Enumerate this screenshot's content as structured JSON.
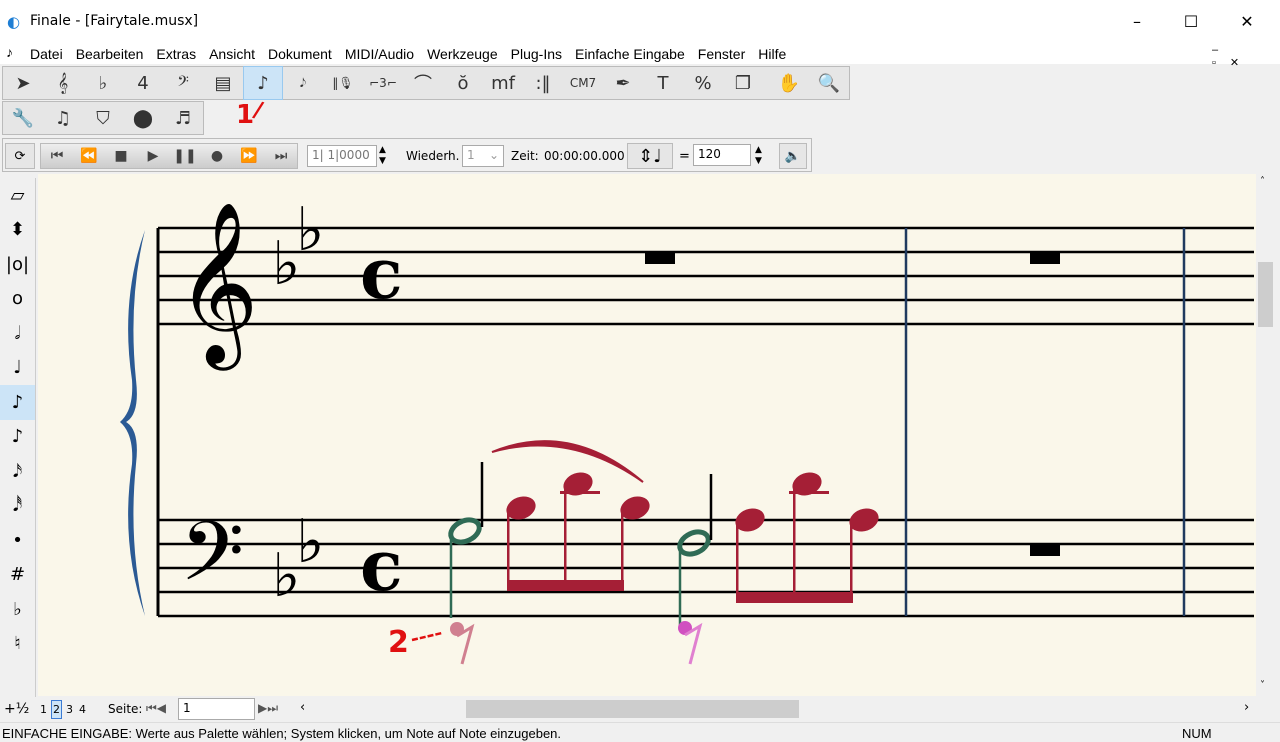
{
  "window": {
    "title": "Finale  - [Fairytale.musx]",
    "minimize": "–",
    "maximize": "☐",
    "close": "✕"
  },
  "menu": [
    "Datei",
    "Bearbeiten",
    "Extras",
    "Ansicht",
    "Dokument",
    "MIDI/Audio",
    "Werkzeuge",
    "Plug-Ins",
    "Einfache Eingabe",
    "Fenster",
    "Hilfe"
  ],
  "toolbar_main": [
    {
      "name": "selection-tool-icon",
      "glyph": "➤"
    },
    {
      "name": "staff-tool-icon",
      "glyph": "𝄞"
    },
    {
      "name": "key-signature-tool-icon",
      "glyph": "♭"
    },
    {
      "name": "time-signature-tool-icon",
      "glyph": "4"
    },
    {
      "name": "clef-tool-icon",
      "glyph": "𝄢"
    },
    {
      "name": "measure-tool-icon",
      "glyph": "▤"
    },
    {
      "name": "simple-entry-tool-icon",
      "glyph": "♪"
    },
    {
      "name": "speedy-entry-tool-icon",
      "glyph": "𝅘𝅥𝅮"
    },
    {
      "name": "hyperscribe-tool-icon",
      "glyph": "‖🎙"
    },
    {
      "name": "tuplet-tool-icon",
      "glyph": "⌐3⌐"
    },
    {
      "name": "smart-shape-tool-icon",
      "glyph": "⌒"
    },
    {
      "name": "articulation-tool-icon",
      "glyph": "ŏ"
    },
    {
      "name": "expression-tool-icon",
      "glyph": "mf"
    },
    {
      "name": "repeat-tool-icon",
      "glyph": ":‖"
    },
    {
      "name": "chord-tool-icon",
      "glyph": "CM7"
    },
    {
      "name": "lyrics-tool-icon",
      "glyph": "✒"
    },
    {
      "name": "text-tool-icon",
      "glyph": "T"
    },
    {
      "name": "resize-tool-icon",
      "glyph": "%"
    },
    {
      "name": "page-layout-tool-icon",
      "glyph": "❐"
    },
    {
      "name": "hand-grabber-icon",
      "glyph": "✋"
    },
    {
      "name": "zoom-tool-icon",
      "glyph": "🔍"
    }
  ],
  "toolbar_second": [
    {
      "name": "wrench-icon",
      "glyph": "🔧"
    },
    {
      "name": "mirror-tool-icon",
      "glyph": "♫"
    },
    {
      "name": "special-tools-icon",
      "glyph": "⛉"
    },
    {
      "name": "midi-tool-icon",
      "glyph": "⬤"
    },
    {
      "name": "beam-tool-icon",
      "glyph": "♬"
    }
  ],
  "annotations": {
    "one": "1",
    "two": "2"
  },
  "playback": {
    "buttons": [
      "⏮",
      "⏪",
      "■",
      "▶",
      "❚❚",
      "●",
      "⏩",
      "⏭"
    ],
    "position": "1| 1|0000",
    "repeat_label": "Wiederh.",
    "repeat_value": "1",
    "time_label": "Zeit:",
    "time_value": "00:00:00.000",
    "equals": "=",
    "tempo": "120"
  },
  "palette": [
    "▱",
    "⬍",
    "|o|",
    "o",
    "𝅗𝅥",
    "♩",
    "♪",
    "♪",
    "𝅘𝅥𝅯",
    "𝅘𝅥𝅰",
    "•",
    "#",
    "♭",
    "♮"
  ],
  "bottom": {
    "fraction": "+½",
    "views": [
      "1",
      "2",
      "3",
      "4"
    ],
    "page_label": "Seite:",
    "page_value": "1"
  },
  "status": {
    "text": "EINFACHE EINGABE: Werte aus Palette wählen; System klicken, um Note auf Note einzugeben.",
    "num": "NUM"
  },
  "score": {
    "treble_clef": "𝄞",
    "bass_clef": "𝄢",
    "time": "c",
    "flat": "♭"
  },
  "colors": {
    "selected": "#cce4f7",
    "barline": "#1f3a5f",
    "note_red": "#a51f36",
    "note_green": "#2f6b55",
    "rest_pink": "#d08090",
    "brace": "#2b5a94"
  }
}
